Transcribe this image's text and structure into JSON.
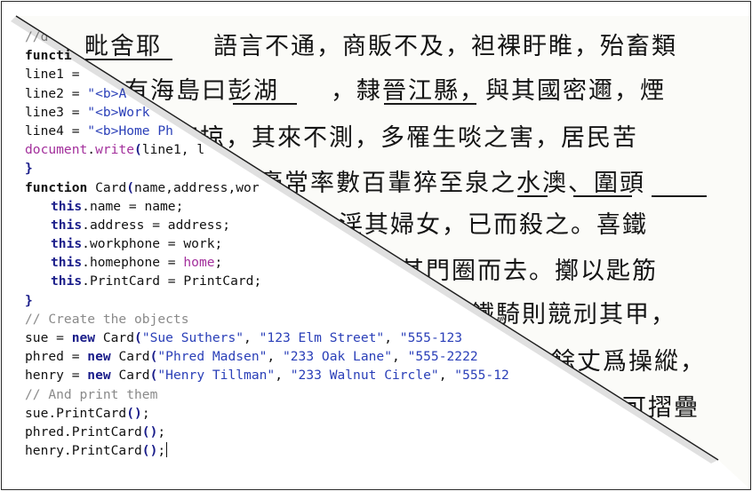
{
  "code": {
    "lines": [
      "//d",
      "functi",
      "line1 = ",
      "line2 = \"<b>A",
      "line3 = \"<b>Work",
      "line4 = \"<b>Home Ph",
      "document.write(line1, l",
      "}",
      "function Card(name,address,wor",
      "this.name = name;",
      "this.address = address;",
      "this.workphone = work;",
      "this.homephone = home;",
      "this.PrintCard = PrintCard;",
      "}",
      "// Create the objects",
      "sue = new Card(\"Sue Suthers\", \"123 Elm Street\", \"555-123",
      "phred = new Card(\"Phred Madsen\", \"233 Oak Lane\", \"555-2222",
      "henry = new Card(\"Henry Tillman\", \"233 Walnut Circle\", \"555-12",
      "// And print them",
      "sue.PrintCard();",
      "phred.PrintCard();",
      "henry.PrintCard();"
    ]
  },
  "book": {
    "lines": [
      "毗舍耶　　語言不通，商販不及，袒裸盱睢，殆畜類",
      "有海島曰彭湖　　，隸晉江縣，與其國密邇，煙",
      "寇掠，其來不測，多罹生啖之害，居民苦",
      "酋豪常率數百輩猝至泉之水澳、圍頭",
      "戮，淫其婦女，已而殺之。喜鐵",
      "其門圈而去。擲以匙筋",
      "見鐵騎則競刓其甲，",
      "餘丈爲操縱，",
      "可摺疊"
    ]
  }
}
